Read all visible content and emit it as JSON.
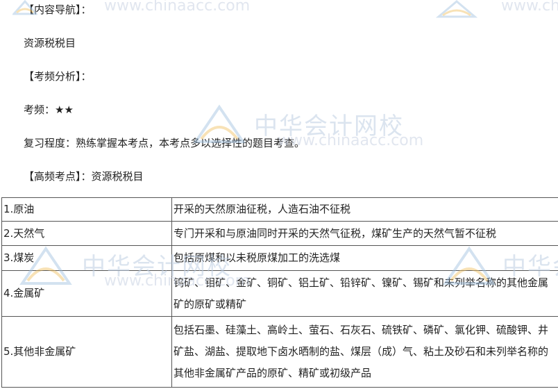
{
  "paragraphs": {
    "nav_label": "【内容导航】：",
    "nav_value": "资源税税目",
    "freq_label": "【考频分析】：",
    "freq": "考频：★★",
    "review": "复习程度：熟练掌握本考点，本考点多以选择性的题目考查。",
    "highfreq": "【高频考点】：资源税税目"
  },
  "watermark": {
    "brand_cn": "中华会计网校",
    "url": "www.chinaacc.com",
    "url_partial_top_right": "www.ch",
    "brand_partial_right": "中华会",
    "brand_partial_left": "中华会计网校"
  },
  "table": {
    "rows": [
      {
        "item": "1.原油",
        "desc": "开采的天然原油征税，人造石油不征税"
      },
      {
        "item": "2.天然气",
        "desc": "专门开采和与原油同时开采的天然气征税，煤矿生产的天然气暂不征税"
      },
      {
        "item": "3.煤炭",
        "desc": "包括原煤和以未税原煤加工的洗选煤"
      },
      {
        "item": "4.金属矿",
        "desc": "钨矿、钼矿、金矿、铜矿、铝土矿、铅锌矿、镍矿、锡矿和未列举名称的其他金属矿的原矿或精矿"
      },
      {
        "item": "5.其他非金属矿",
        "desc": "包括石墨、硅藻土、高岭土、萤石、石灰石、硫铁矿、磷矿、氯化钾、硫酸钾、井矿盐、湖盐、提取地下卤水晒制的盐、煤层（成）气、粘土及砂石和未列举名称的其他非金属矿产品的原矿、精矿或初级产品"
      }
    ]
  }
}
